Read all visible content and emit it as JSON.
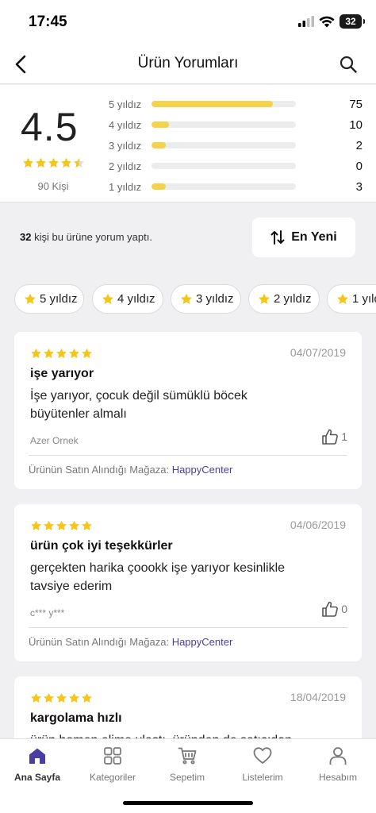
{
  "status": {
    "time": "17:45",
    "battery": "32"
  },
  "nav": {
    "title": "Ürün Yorumları",
    "back_icon": "chevron-left-icon",
    "search_icon": "search-icon"
  },
  "summary": {
    "average": "4.5",
    "average_stars": 4.5,
    "count_label": "90 Kişi",
    "distribution": [
      {
        "label": "5 yıldız",
        "count": "75",
        "fraction": 0.84
      },
      {
        "label": "4 yıldız",
        "count": "10",
        "fraction": 0.12
      },
      {
        "label": "3 yıldız",
        "count": "2",
        "fraction": 0.1
      },
      {
        "label": "2 yıldız",
        "count": "0",
        "fraction": 0.0
      },
      {
        "label": "1 yıldız",
        "count": "3",
        "fraction": 0.1
      }
    ],
    "bar_color": "#f5d24a"
  },
  "info": {
    "count": "32",
    "text": "kişi bu ürüne yorum yaptı."
  },
  "sort": {
    "label": "En Yeni",
    "icon": "sort-arrows-icon"
  },
  "filters": [
    {
      "label": "5 yıldız"
    },
    {
      "label": "4 yıldız"
    },
    {
      "label": "3 yıldız"
    },
    {
      "label": "2 yıldız"
    },
    {
      "label": "1 yıldız"
    }
  ],
  "reviews": [
    {
      "stars": 5,
      "date": "04/07/2019",
      "title": "işe yarıyor",
      "body": "İşe yarıyor, çocuk değil sümüklü böcek büyütenler almalı",
      "author": "Azer Ornek",
      "likes": "1",
      "store_label": "Ürünün Satın Alındığı Mağaza:",
      "store_name": "HappyCenter"
    },
    {
      "stars": 5,
      "date": "04/06/2019",
      "title": "ürün çok iyi teşekkürler",
      "body": "gerçekten harika çoookk işe yarıyor kesinlikle tavsiye ederim",
      "author": "c*** y***",
      "likes": "0",
      "store_label": "Ürünün Satın Alındığı Mağaza:",
      "store_name": "HappyCenter"
    },
    {
      "stars": 5,
      "date": "18/04/2019",
      "title": "kargolama hızlı",
      "body": "ürün hemen elime ulaştı, üründen de satıcıdan da",
      "author": "",
      "likes": "",
      "store_label": "",
      "store_name": ""
    }
  ],
  "tabs": [
    {
      "label": "Ana Sayfa",
      "icon": "home-icon",
      "active": true
    },
    {
      "label": "Kategoriler",
      "icon": "grid-icon",
      "active": false
    },
    {
      "label": "Sepetim",
      "icon": "cart-icon",
      "active": false
    },
    {
      "label": "Listelerim",
      "icon": "heart-icon",
      "active": false
    },
    {
      "label": "Hesabım",
      "icon": "user-icon",
      "active": false
    }
  ],
  "colors": {
    "accent": "#4a3fa0",
    "star": "#f5c518",
    "background": "#f0f0f2"
  }
}
